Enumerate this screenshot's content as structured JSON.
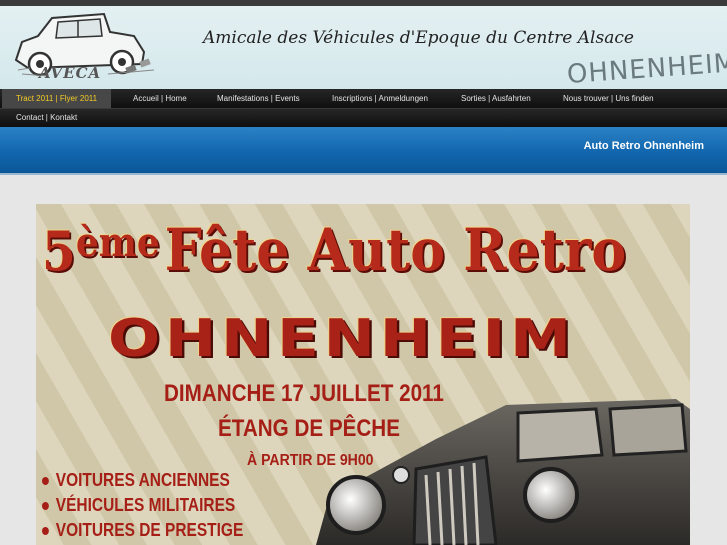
{
  "header": {
    "logo_text": "AVECA",
    "site_title": "Amicale des Véhicules d'Epoque du Centre Alsace",
    "site_town": "OHNENHEIM"
  },
  "nav": {
    "row1": [
      {
        "label": "Tract 2011 | Flyer 2011",
        "active": true
      },
      {
        "label": "Accueil | Home"
      },
      {
        "label": "Manifestations | Events"
      },
      {
        "label": "Inscriptions | Anmeldungen"
      },
      {
        "label": "Sorties | Ausfahrten"
      },
      {
        "label": "Nous trouver | Uns finden"
      }
    ],
    "row2": [
      {
        "label": "Contact | Kontakt"
      }
    ]
  },
  "banner": {
    "title": "Auto Retro Ohnenheim"
  },
  "poster": {
    "edition_number": "5",
    "edition_suffix": "ème",
    "headline": "Fête Auto Retro",
    "town": "OHNENHEIM",
    "date": "DIMANCHE 17 JUILLET 2011",
    "place": "ÉTANG DE PÊCHE",
    "time": "À PARTIR DE 9H00",
    "items": [
      "VOITURES ANCIENNES",
      "VÉHICULES MILITAIRES",
      "VOITURES DE PRESTIGE"
    ]
  },
  "colors": {
    "nav_active_text": "#f4cc25",
    "banner_blue": "#1a6fb4",
    "poster_red": "#a61f17"
  },
  "icons": {
    "logo": "vintage-car-logo-icon",
    "poster_car": "vintage-car-illustration-icon"
  }
}
